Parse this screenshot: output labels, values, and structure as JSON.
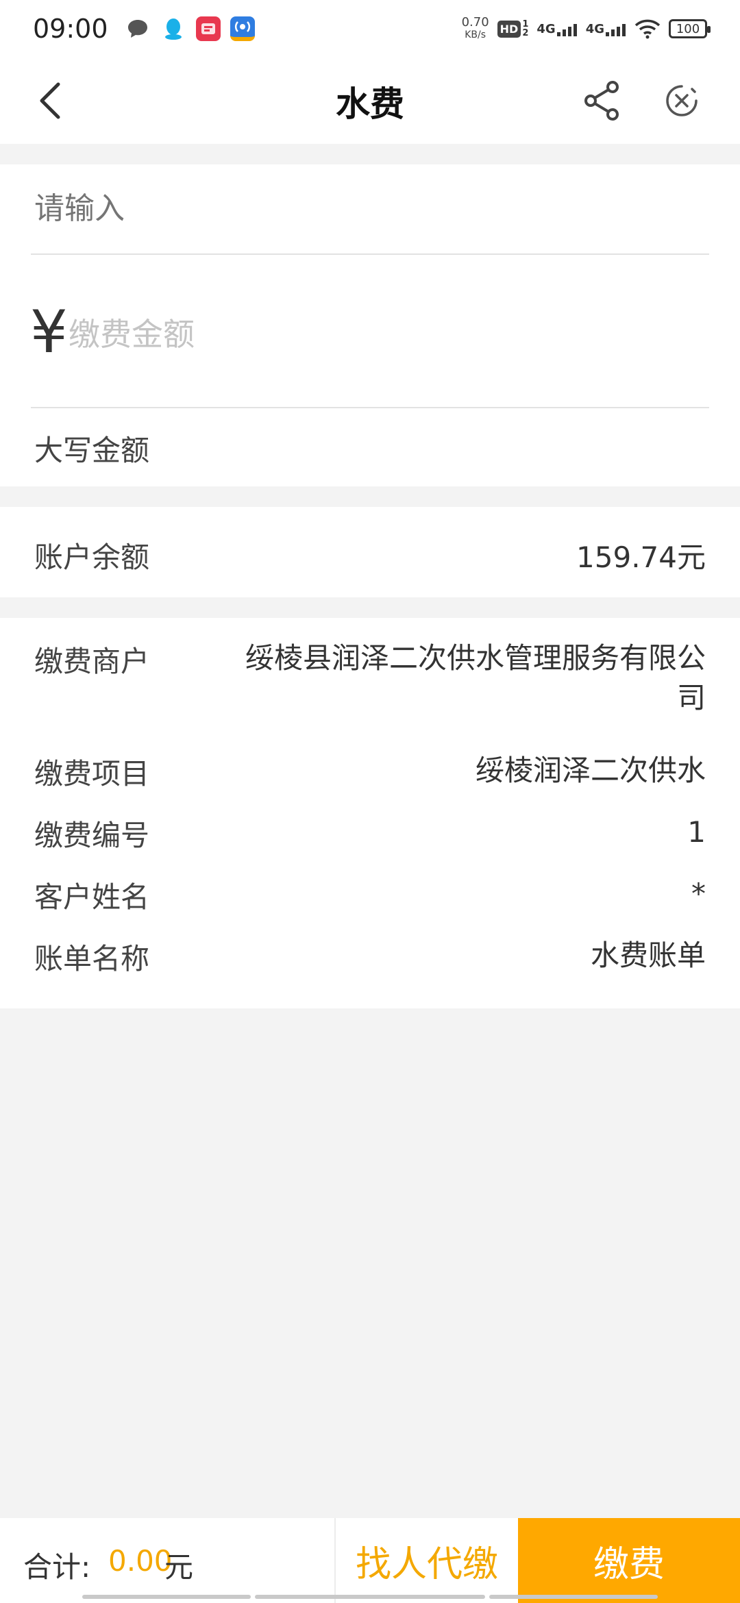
{
  "status_bar": {
    "time": "09:00",
    "net_speed_value": "0.70",
    "net_speed_unit": "KB/s",
    "hd_label": "HD",
    "sim1_label": "4G",
    "sim2_label": "4G",
    "battery": "100",
    "icons": [
      "message-icon",
      "qq-icon",
      "app-badge-icon",
      "app-signal-icon",
      "wifi-icon"
    ]
  },
  "header": {
    "title": "水费",
    "back_icon": "chevron-left-icon",
    "share_icon": "share-icon",
    "close_icon": "close-circle-icon"
  },
  "form": {
    "account_placeholder": "请输入",
    "currency_symbol": "¥",
    "amount_placeholder": "缴费金额",
    "uppercase_label": "大写金额"
  },
  "balance": {
    "label": "账户余额",
    "value": "159.74元"
  },
  "details": {
    "merchant_label": "缴费商户",
    "merchant_value": "绥棱县润泽二次供水管理服务有限公司",
    "item_label": "缴费项目",
    "item_value": "绥棱润泽二次供水",
    "number_label": "缴费编号",
    "number_value": "1",
    "customer_label": "客户姓名",
    "customer_value": "*",
    "bill_label": "账单名称",
    "bill_value": "水费账单"
  },
  "bottom_bar": {
    "total_label": "合计:",
    "total_amount": "0.00",
    "total_unit": "元",
    "proxy_pay_label": "找人代缴",
    "pay_label": "缴费"
  },
  "colors": {
    "accent": "#ffa800",
    "accent_text": "#f4a800",
    "background": "#f3f3f3"
  }
}
